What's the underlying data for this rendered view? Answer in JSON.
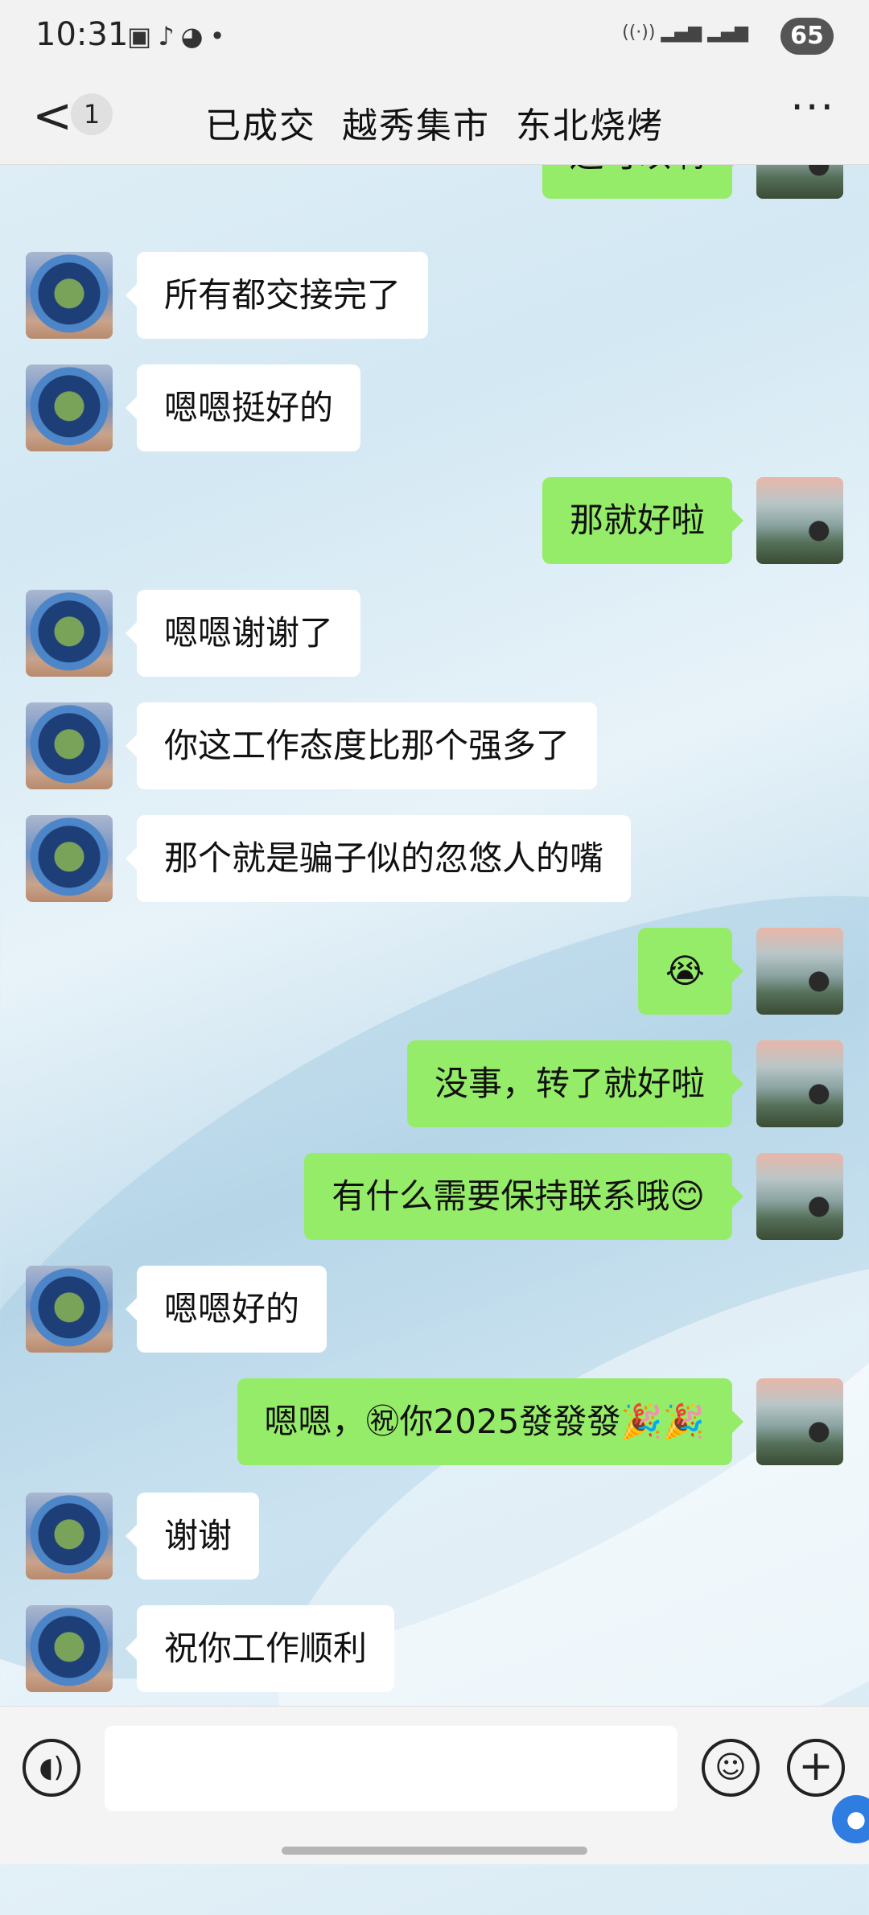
{
  "status_bar": {
    "time": "10:31",
    "notification_icons": [
      "screenshot-icon",
      "tiktok-icon",
      "wechat-icon",
      "dot-icon"
    ],
    "network": "6 5G 5G",
    "battery": "65"
  },
  "nav": {
    "back_label": "<",
    "unread_count": "1",
    "title": "已成交  越秀集市  东北烧烤",
    "more_label": "···"
  },
  "messages": [
    {
      "side": "out",
      "text": "还可以啊"
    },
    {
      "side": "in",
      "text": "所有都交接完了"
    },
    {
      "side": "in",
      "text": "嗯嗯挺好的"
    },
    {
      "side": "out",
      "text": "那就好啦"
    },
    {
      "side": "in",
      "text": "嗯嗯谢谢了"
    },
    {
      "side": "in",
      "text": "你这工作态度比那个强多了"
    },
    {
      "side": "in",
      "text": "那个就是骗子似的忽悠人的嘴"
    },
    {
      "side": "out",
      "text": "😭"
    },
    {
      "side": "out",
      "text": "没事，转了就好啦"
    },
    {
      "side": "out",
      "text": "有什么需要保持联系哦😊"
    },
    {
      "side": "in",
      "text": "嗯嗯好的"
    },
    {
      "side": "out",
      "text": "嗯嗯，㊗你2025發發發🎉🎉"
    },
    {
      "side": "in",
      "text": "谢谢"
    },
    {
      "side": "in",
      "text": "祝你工作顺利"
    }
  ],
  "input_bar": {
    "voice_icon": "voice-icon",
    "emoji_icon": "emoji-icon",
    "plus_icon": "plus-icon"
  },
  "colors": {
    "outgoing_bubble": "#95ec69",
    "incoming_bubble": "#ffffff",
    "bar_background": "#f2f2f2"
  }
}
